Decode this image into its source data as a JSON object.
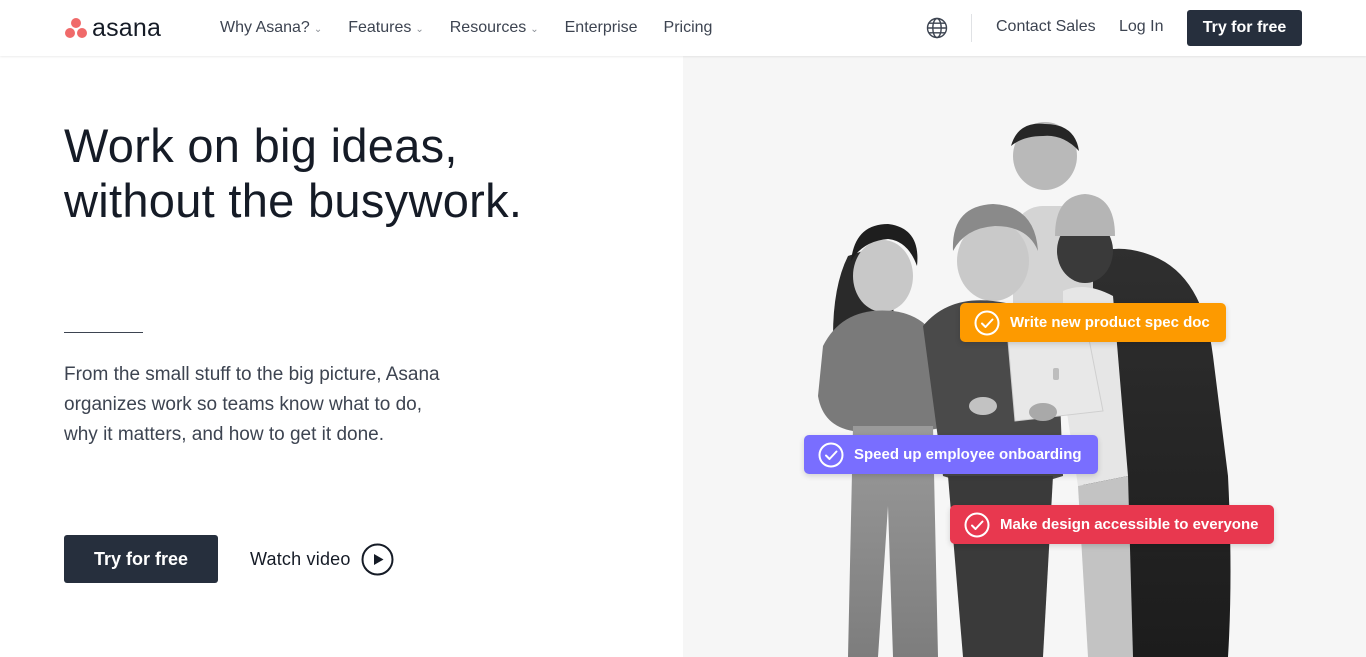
{
  "brand": {
    "name": "asana",
    "logo_color": "#f06a6a"
  },
  "nav": {
    "items": [
      {
        "label": "Why Asana?",
        "has_dropdown": true
      },
      {
        "label": "Features",
        "has_dropdown": true
      },
      {
        "label": "Resources",
        "has_dropdown": true
      },
      {
        "label": "Enterprise",
        "has_dropdown": false
      },
      {
        "label": "Pricing",
        "has_dropdown": false
      }
    ],
    "globe_icon": "globe-icon",
    "contact_label": "Contact Sales",
    "login_label": "Log In",
    "cta_label": "Try for free"
  },
  "hero": {
    "title_line1": "Work on big ideas,",
    "title_line2": "without the busywork.",
    "subtitle": "From the small stuff to the big picture, Asana organizes work so teams know what to do, why it matters, and how to get it done.",
    "cta_label": "Try for free",
    "watch_label": "Watch video",
    "play_icon": "play-circle-icon"
  },
  "tasks": [
    {
      "label": "Write new product spec doc",
      "color": "#fd9a00"
    },
    {
      "label": "Speed up employee onboarding",
      "color": "#796eff"
    },
    {
      "label": "Make design accessible to everyone",
      "color": "#e8384f"
    }
  ],
  "colors": {
    "dark_button": "#262f3d",
    "text_primary": "#151b26",
    "text_secondary": "#3d4451",
    "panel_bg": "#f6f6f6"
  }
}
